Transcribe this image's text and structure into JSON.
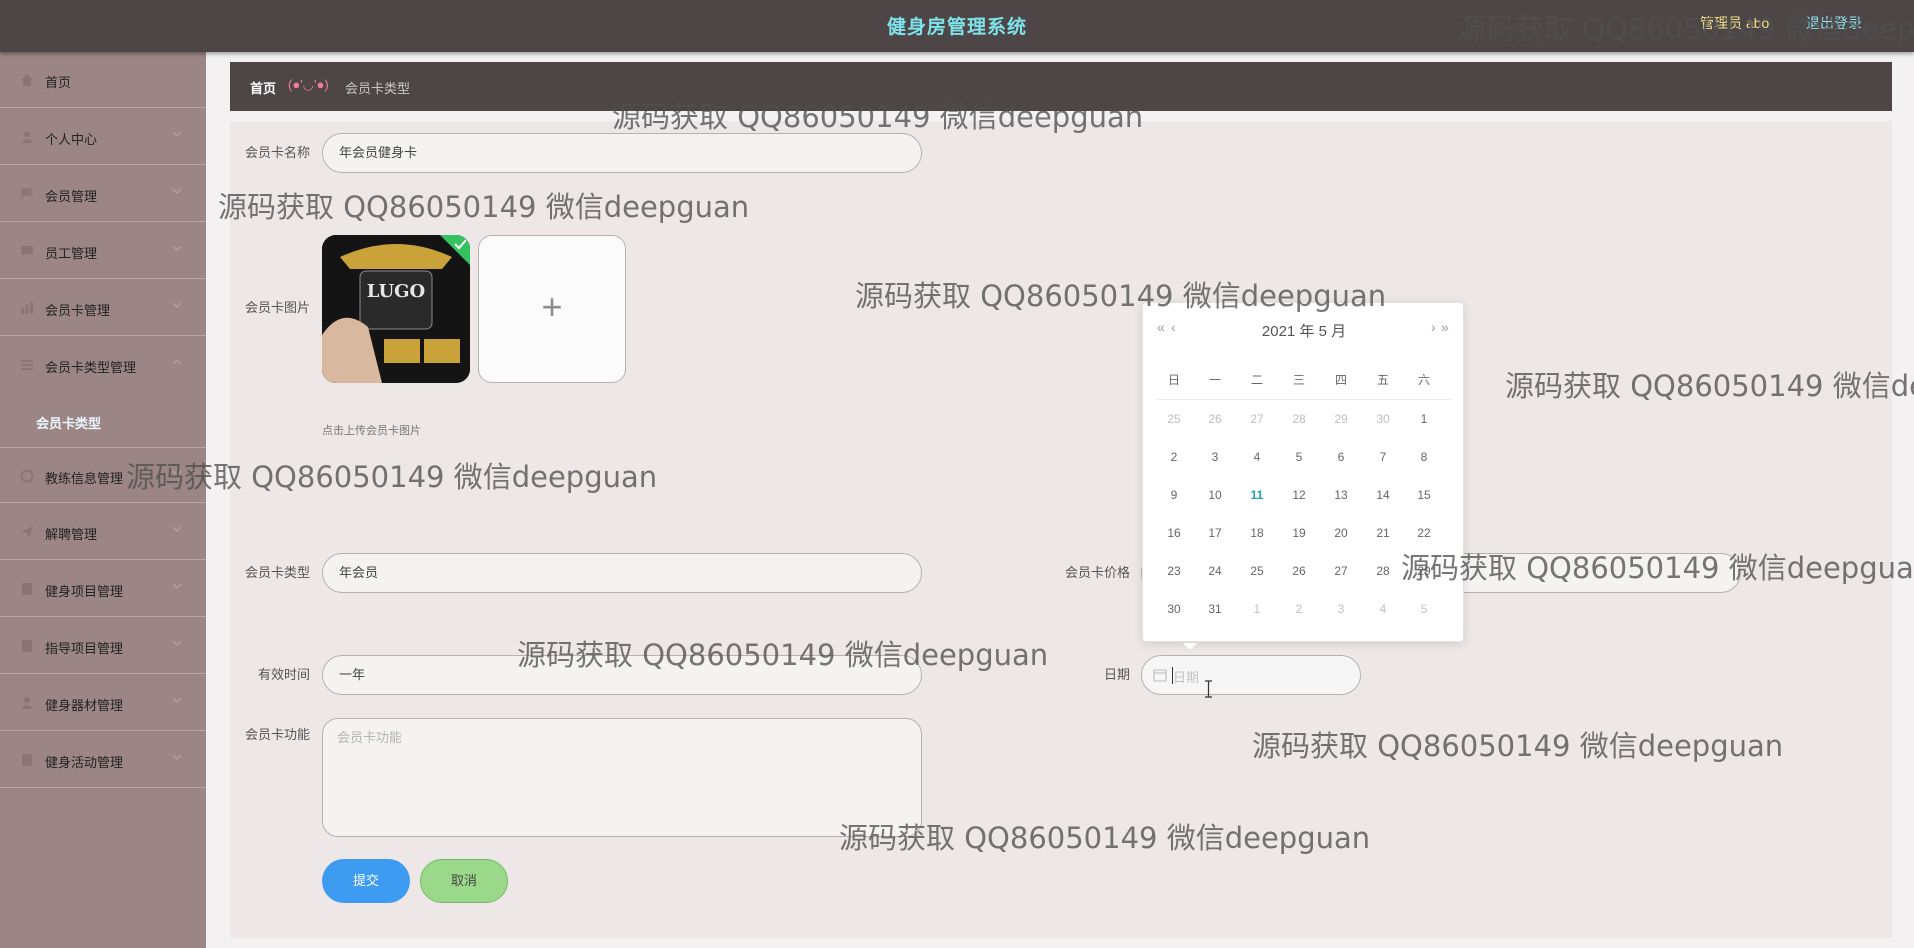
{
  "header": {
    "title": "健身房管理系统",
    "user_label": "管理员 abo",
    "logout_label": "退出登录"
  },
  "sidebar": {
    "items": [
      {
        "label": "首页",
        "icon": "home-icon"
      },
      {
        "label": "个人中心",
        "icon": "user-icon"
      },
      {
        "label": "会员管理",
        "icon": "flag-icon"
      },
      {
        "label": "员工管理",
        "icon": "chat-icon"
      },
      {
        "label": "会员卡管理",
        "icon": "chart-icon"
      },
      {
        "label": "会员卡类型管理",
        "icon": "list-icon"
      },
      {
        "label": "教练信息管理",
        "icon": "circle-icon"
      },
      {
        "label": "解聘管理",
        "icon": "send-icon"
      },
      {
        "label": "健身项目管理",
        "icon": "doc-icon"
      },
      {
        "label": "指导项目管理",
        "icon": "doc-icon"
      },
      {
        "label": "健身器材管理",
        "icon": "user-icon"
      },
      {
        "label": "健身活动管理",
        "icon": "doc-icon"
      }
    ],
    "sub_item": "会员卡类型"
  },
  "breadcrumb": {
    "home": "首页",
    "face": "(●'◡'●)",
    "current": "会员卡类型"
  },
  "form": {
    "card_name_label": "会员卡名称",
    "card_name_value": "年会员健身卡",
    "card_image_label": "会员卡图片",
    "card_image_text": "LUGO",
    "upload_hint": "点击上传会员卡图片",
    "card_type_label": "会员卡类型",
    "card_type_value": "年会员",
    "card_price_label": "会员卡价格",
    "valid_time_label": "有效时间",
    "valid_time_value": "一年",
    "date_label": "日期",
    "date_placeholder": "日期",
    "features_label": "会员卡功能",
    "features_placeholder": "会员卡功能",
    "submit_label": "提交",
    "cancel_label": "取消"
  },
  "datepicker": {
    "title": "2021 年  5 月",
    "prev_year": "«",
    "prev_month": "‹",
    "next_month": "›",
    "next_year": "»",
    "weekdays": [
      "日",
      "一",
      "二",
      "三",
      "四",
      "五",
      "六"
    ],
    "days": [
      [
        "25",
        "26",
        "27",
        "28",
        "29",
        "30",
        "1"
      ],
      [
        "2",
        "3",
        "4",
        "5",
        "6",
        "7",
        "8"
      ],
      [
        "9",
        "10",
        "11",
        "12",
        "13",
        "14",
        "15"
      ],
      [
        "16",
        "17",
        "18",
        "19",
        "20",
        "21",
        "22"
      ],
      [
        "23",
        "24",
        "25",
        "26",
        "27",
        "28",
        "29"
      ],
      [
        "30",
        "31",
        "1",
        "2",
        "3",
        "4",
        "5"
      ]
    ],
    "today": "11"
  },
  "watermark_text": "源码获取 QQ86050149 微信deepguan",
  "colors": {
    "topbar": "#4d4546",
    "sidebar": "#9c8685",
    "title": "#7fe3ea",
    "submit": "#3d9bf2",
    "cancel": "#9ad98a",
    "today": "#21a1a8"
  }
}
